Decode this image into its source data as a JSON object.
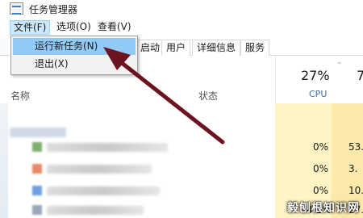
{
  "window": {
    "title": "任务管理器"
  },
  "menubar": {
    "items": [
      {
        "label": "文件(F)"
      },
      {
        "label": "选项(O)"
      },
      {
        "label": "查看(V)"
      }
    ]
  },
  "file_menu": {
    "items": [
      {
        "label": "运行新任务(N)"
      },
      {
        "label": "退出(X)"
      }
    ]
  },
  "tabs": [
    {
      "label": "启动"
    },
    {
      "label": "用户"
    },
    {
      "label": "详细信息"
    },
    {
      "label": "服务"
    }
  ],
  "columns": {
    "name": "名称",
    "status": "状态",
    "cpu_percent": "27%",
    "cpu_label": "CPU"
  },
  "rows": [
    {
      "cpu": "0%",
      "mem": "53."
    },
    {
      "cpu": "0%",
      "mem": "3."
    },
    {
      "cpu": "0%",
      "mem": "10."
    },
    {
      "cpu": "4.2%",
      "mem": "27."
    }
  ],
  "watermark": {
    "text": "毅刨根知识网"
  },
  "colors": {
    "menu_active": "#cce8ff",
    "menu_highlight": "#91c9f7",
    "cpu_band": "#fff4c4",
    "arrow": "#6b1420"
  }
}
